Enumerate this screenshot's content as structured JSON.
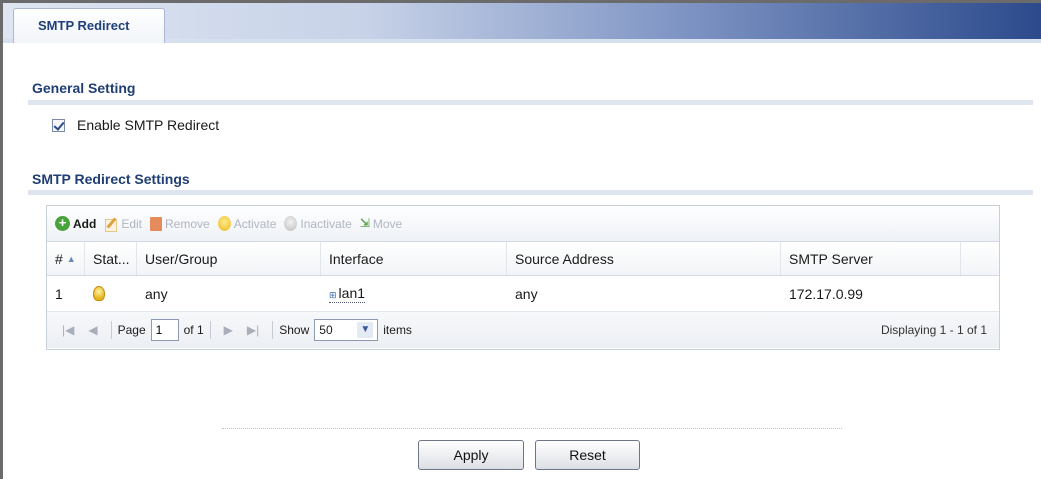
{
  "tab": {
    "label": "SMTP Redirect"
  },
  "general": {
    "title": "General Setting",
    "enable_label": "Enable SMTP Redirect",
    "enable_checked": true
  },
  "settings": {
    "title": "SMTP Redirect Settings",
    "toolbar": {
      "add": "Add",
      "edit": "Edit",
      "remove": "Remove",
      "activate": "Activate",
      "inactivate": "Inactivate",
      "move": "Move"
    },
    "columns": [
      "#",
      "Stat...",
      "User/Group",
      "Interface",
      "Source Address",
      "SMTP Server"
    ],
    "rows": [
      {
        "num": "1",
        "status": "active-bulb-icon",
        "user_group": "any",
        "interface": "lan1",
        "source_address": "any",
        "smtp_server": "172.17.0.99"
      }
    ],
    "pager": {
      "page_label": "Page",
      "page_value": "1",
      "of_label": "of 1",
      "show_label": "Show",
      "show_value": "50",
      "items_label": "items",
      "displaying": "Displaying 1 - 1 of 1"
    }
  },
  "buttons": {
    "apply": "Apply",
    "reset": "Reset"
  },
  "colors": {
    "section_title": "#1f3e73",
    "tab_text": "#1e3f7a",
    "add_icon": "#4aa33a"
  }
}
